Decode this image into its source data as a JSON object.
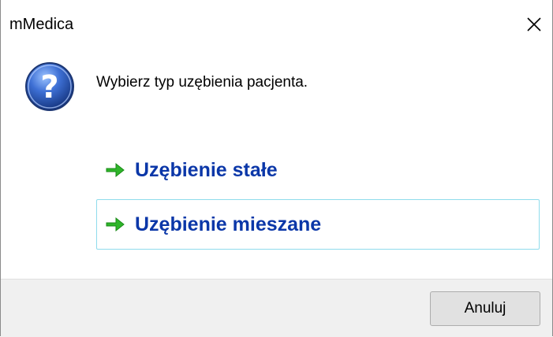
{
  "window": {
    "title": "mMedica",
    "close_icon": "close-icon"
  },
  "dialog": {
    "icon": "question-icon",
    "prompt": "Wybierz typ uzębienia pacjenta.",
    "commands": [
      {
        "label": "Uzębienie stałe",
        "icon": "green-arrow-icon"
      },
      {
        "label": "Uzębienie mieszane",
        "icon": "green-arrow-icon",
        "focused": true
      }
    ]
  },
  "footer": {
    "cancel_label": "Anuluj"
  },
  "colors": {
    "link_blue": "#0b37a8",
    "arrow_green": "#2fb52a",
    "focus_border": "#8fdcec"
  }
}
